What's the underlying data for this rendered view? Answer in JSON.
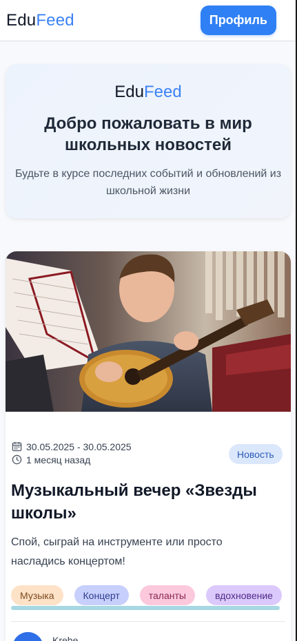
{
  "header": {
    "logo_part1": "Edu",
    "logo_part2": "Feed",
    "profile_button": "Профиль"
  },
  "hero": {
    "logo_part1": "Edu",
    "logo_part2": "Feed",
    "title": "Добро пожаловать в мир школьных новостей",
    "subtitle": "Будьте в курсе последних событий и обновлений из школьной жизни"
  },
  "post": {
    "image_alt": "boy-playing-guitar",
    "date_range": "30.05.2025 - 30.05.2025",
    "relative_time": "1 месяц назад",
    "badge": "Новость",
    "title": "Музыкальный вечер «Звезды школы»",
    "description": "Спой, сыграй на инструменте или просто насладись концертом!",
    "tags": [
      "Музыка",
      "Концерт",
      "таланты",
      "вдохновение"
    ],
    "author_name": "Krebe"
  },
  "colors": {
    "accent": "#2f80f4",
    "badge_bg": "#dbe7fb"
  }
}
